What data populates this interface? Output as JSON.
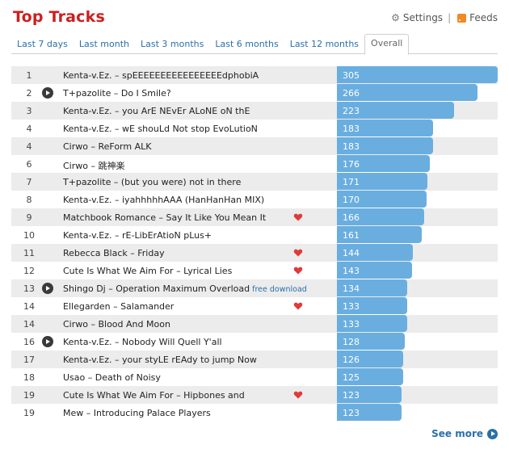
{
  "header": {
    "title": "Top Tracks",
    "settings_label": "Settings",
    "separator": "|",
    "feeds_label": "Feeds"
  },
  "tabs": [
    {
      "label": "Last 7 days",
      "active": false
    },
    {
      "label": "Last month",
      "active": false
    },
    {
      "label": "Last 3 months",
      "active": false
    },
    {
      "label": "Last 6 months",
      "active": false
    },
    {
      "label": "Last 12 months",
      "active": false
    },
    {
      "label": "Overall",
      "active": true
    }
  ],
  "colors": {
    "title": "#cc1f1f",
    "bar": "#6aaee0",
    "heart": "#e03a3a",
    "link": "#2a6fa8"
  },
  "chart_data": {
    "type": "bar",
    "max_value": 305,
    "tracks": [
      {
        "rank": "1",
        "track": "Kenta-v.Ez. – spEEEEEEEEEEEEEEEEdphobiA",
        "plays": 305,
        "play": false,
        "loved": false,
        "download": ""
      },
      {
        "rank": "2",
        "track": "T+pazolite – Do I Smile?",
        "plays": 266,
        "play": true,
        "loved": false,
        "download": ""
      },
      {
        "rank": "3",
        "track": "Kenta-v.Ez. – you ArE NEvEr ALoNE oN thE",
        "plays": 223,
        "play": false,
        "loved": false,
        "download": ""
      },
      {
        "rank": "4",
        "track": "Kenta-v.Ez. – wE shouLd Not stop EvoLutioN",
        "plays": 183,
        "play": false,
        "loved": false,
        "download": ""
      },
      {
        "rank": "4",
        "track": "Cirwo – ReForm ALK",
        "plays": 183,
        "play": false,
        "loved": false,
        "download": ""
      },
      {
        "rank": "6",
        "track": "Cirwo – 跳神楽",
        "plays": 176,
        "play": false,
        "loved": false,
        "download": ""
      },
      {
        "rank": "7",
        "track": "T+pazolite – (but you were) not in there",
        "plays": 171,
        "play": false,
        "loved": false,
        "download": ""
      },
      {
        "rank": "8",
        "track": "Kenta-v.Ez. – iyahhhhhAAA (HanHanHan MIX)",
        "plays": 170,
        "play": false,
        "loved": false,
        "download": ""
      },
      {
        "rank": "9",
        "track": "Matchbook Romance – Say It Like You Mean It",
        "plays": 166,
        "play": false,
        "loved": true,
        "download": ""
      },
      {
        "rank": "10",
        "track": "Kenta-v.Ez. – rE-LibErAtioN pLus+",
        "plays": 161,
        "play": false,
        "loved": false,
        "download": ""
      },
      {
        "rank": "11",
        "track": "Rebecca Black – Friday",
        "plays": 144,
        "play": false,
        "loved": true,
        "download": ""
      },
      {
        "rank": "12",
        "track": "Cute Is What We Aim For – Lyrical Lies",
        "plays": 143,
        "play": false,
        "loved": true,
        "download": ""
      },
      {
        "rank": "13",
        "track": "Shingo Dj – Operation Maximum Overload",
        "plays": 134,
        "play": true,
        "loved": false,
        "download": "free download"
      },
      {
        "rank": "14",
        "track": "Ellegarden – Salamander",
        "plays": 133,
        "play": false,
        "loved": true,
        "download": ""
      },
      {
        "rank": "14",
        "track": "Cirwo – Blood And Moon",
        "plays": 133,
        "play": false,
        "loved": false,
        "download": ""
      },
      {
        "rank": "16",
        "track": "Kenta-v.Ez. – Nobody Will Quell Y'all",
        "plays": 128,
        "play": true,
        "loved": false,
        "download": ""
      },
      {
        "rank": "17",
        "track": "Kenta-v.Ez. – your styLE rEAdy to jump Now",
        "plays": 126,
        "play": false,
        "loved": false,
        "download": ""
      },
      {
        "rank": "18",
        "track": "Usao – Death of Noisy",
        "plays": 125,
        "play": false,
        "loved": false,
        "download": ""
      },
      {
        "rank": "19",
        "track": "Cute Is What We Aim For – Hipbones and",
        "plays": 123,
        "play": false,
        "loved": true,
        "download": ""
      },
      {
        "rank": "19",
        "track": "Mew – Introducing Palace Players",
        "plays": 123,
        "play": false,
        "loved": false,
        "download": ""
      }
    ]
  },
  "footer": {
    "see_more_label": "See more"
  }
}
